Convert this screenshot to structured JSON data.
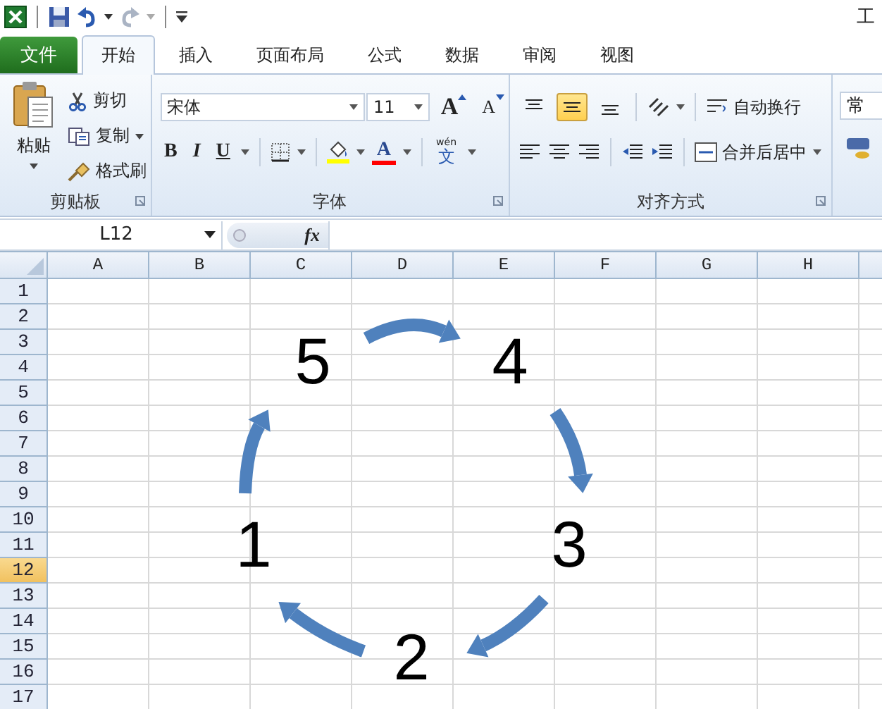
{
  "window": {
    "title": "工"
  },
  "tabs": [
    {
      "label": "文件",
      "kind": "file",
      "selected": false
    },
    {
      "label": "开始",
      "kind": "tab",
      "selected": true
    },
    {
      "label": "插入",
      "kind": "tab",
      "selected": false
    },
    {
      "label": "页面布局",
      "kind": "tab",
      "selected": false
    },
    {
      "label": "公式",
      "kind": "tab",
      "selected": false
    },
    {
      "label": "数据",
      "kind": "tab",
      "selected": false
    },
    {
      "label": "审阅",
      "kind": "tab",
      "selected": false
    },
    {
      "label": "视图",
      "kind": "tab",
      "selected": false
    }
  ],
  "clipboard": {
    "label": "剪贴板",
    "paste": "粘贴",
    "cut": "剪切",
    "copy": "复制",
    "format_painter": "格式刷"
  },
  "font": {
    "label": "字体",
    "font_name": "宋体",
    "font_size": "11",
    "grow": "A",
    "shrink": "A",
    "bold": "B",
    "italic": "I",
    "underline": "U",
    "color_letter": "A",
    "phonetic_top": "wén",
    "phonetic_main": "文"
  },
  "alignment": {
    "label": "对齐方式",
    "vertical": [
      {
        "kind": "top",
        "selected": false
      },
      {
        "kind": "middle",
        "selected": true
      },
      {
        "kind": "bottom",
        "selected": false
      }
    ],
    "wrap_text": "自动换行",
    "merge_center": "合并后居中"
  },
  "number": {
    "format": "常"
  },
  "name_box": "L12",
  "formula_label": "fx",
  "columns": [
    "A",
    "B",
    "C",
    "D",
    "E",
    "F",
    "G",
    "H"
  ],
  "rows": [
    {
      "label": "1",
      "selected": false
    },
    {
      "label": "2",
      "selected": false
    },
    {
      "label": "3",
      "selected": false
    },
    {
      "label": "4",
      "selected": false
    },
    {
      "label": "5",
      "selected": false
    },
    {
      "label": "6",
      "selected": false
    },
    {
      "label": "7",
      "selected": false
    },
    {
      "label": "8",
      "selected": false
    },
    {
      "label": "9",
      "selected": false
    },
    {
      "label": "10",
      "selected": false
    },
    {
      "label": "11",
      "selected": false
    },
    {
      "label": "12",
      "selected": true
    },
    {
      "label": "13",
      "selected": false
    },
    {
      "label": "14",
      "selected": false
    },
    {
      "label": "15",
      "selected": false
    },
    {
      "label": "16",
      "selected": false
    },
    {
      "label": "17",
      "selected": false
    }
  ],
  "diagram": {
    "labels": [
      "5",
      "4",
      "1",
      "3",
      "2"
    ]
  }
}
